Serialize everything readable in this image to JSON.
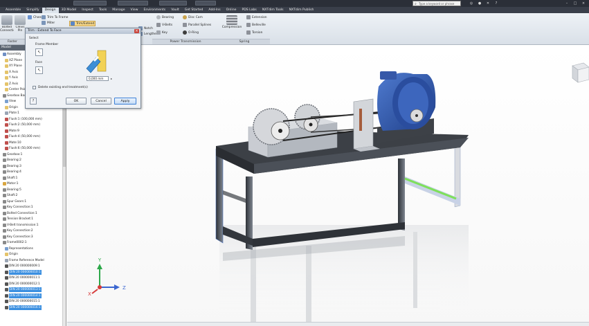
{
  "title_bar": {
    "search_placeholder": "Type a keyword or phrase"
  },
  "tabs": [
    "Assemble",
    "Simplify",
    "Design",
    "3D Model",
    "Inspect",
    "Tools",
    "Manage",
    "View",
    "Environments",
    "Vault",
    "Get Started",
    "Add-Ins",
    "Online",
    "PDS Labs",
    "NXTdim Tools",
    "NXTdim Publish"
  ],
  "active_tab": "Design",
  "ribbon": {
    "groups": [
      "Faster",
      "Power Transmission",
      "Spring"
    ],
    "left_items": [
      "Bolted Connection",
      "Clevis Pin",
      "Change",
      "Trim To Frame",
      "Miter",
      "Trim/Extend",
      "Notch",
      "Lengthen"
    ],
    "power_items": [
      "Bearing",
      "V-Belts",
      "Key",
      "Disc Cam",
      "Parallel Splines",
      "O-Ring"
    ],
    "spring_items": [
      "Compression",
      "Extension",
      "Belleville",
      "Torsion"
    ]
  },
  "dialog": {
    "title": "Trim - Extend To Face",
    "select_label": "Select",
    "frame_member_label": "Frame Member",
    "face_label": "Face",
    "offset_value": "0,000 mm",
    "delete_label": "Delete existing end treatment(s)",
    "ok": "OK",
    "cancel": "Cancel",
    "apply": "Apply"
  },
  "browser": {
    "header": "Model",
    "rows": [
      {
        "label": "Assembly",
        "indent": 1,
        "icon": "#6f8fc4",
        "sel": false
      },
      {
        "label": "XZ Plane",
        "indent": 2,
        "icon": "#e5c46a",
        "sel": false
      },
      {
        "label": "XY Plane",
        "indent": 2,
        "icon": "#e5c46a",
        "sel": false
      },
      {
        "label": "X Axis",
        "indent": 2,
        "icon": "#e5c46a",
        "sel": false
      },
      {
        "label": "Y Axis",
        "indent": 2,
        "icon": "#e5c46a",
        "sel": false
      },
      {
        "label": "Z Axis",
        "indent": 2,
        "icon": "#e5c46a",
        "sel": false
      },
      {
        "label": "Center Point",
        "indent": 2,
        "icon": "#e5c46a",
        "sel": false
      },
      {
        "label": "Gearbox Base:1",
        "indent": 1,
        "icon": "#8a8a8a",
        "sel": false
      },
      {
        "label": "View",
        "indent": 2,
        "icon": "#7aa0d0",
        "sel": false
      },
      {
        "label": "Origin",
        "indent": 2,
        "icon": "#e5c46a",
        "sel": false
      },
      {
        "label": "Plate:1",
        "indent": 2,
        "icon": "#9aa5b5",
        "sel": false
      },
      {
        "label": "Flush:1 (100,000 mm)",
        "indent": 2,
        "icon": "#c0504d",
        "sel": false
      },
      {
        "label": "Flush:2 (50,000 mm)",
        "indent": 2,
        "icon": "#c0504d",
        "sel": false
      },
      {
        "label": "Mate:9",
        "indent": 2,
        "icon": "#c0504d",
        "sel": false
      },
      {
        "label": "Flush:4 (50,000 mm)",
        "indent": 2,
        "icon": "#c0504d",
        "sel": false
      },
      {
        "label": "Mate:10",
        "indent": 2,
        "icon": "#c0504d",
        "sel": false
      },
      {
        "label": "Flush:6 (50,000 mm)",
        "indent": 2,
        "icon": "#c0504d",
        "sel": false
      },
      {
        "label": "Gearbox:1",
        "indent": 1,
        "icon": "#8a8a8a",
        "sel": false
      },
      {
        "label": "Bearing:2",
        "indent": 1,
        "icon": "#8a8a8a",
        "sel": false
      },
      {
        "label": "Bearing:3",
        "indent": 1,
        "icon": "#8a8a8a",
        "sel": false
      },
      {
        "label": "Bearing:4",
        "indent": 1,
        "icon": "#8a8a8a",
        "sel": false
      },
      {
        "label": "Shaft:1",
        "indent": 1,
        "icon": "#8a8a8a",
        "sel": false
      },
      {
        "label": "Motor:1",
        "indent": 1,
        "icon": "#d9a640",
        "sel": false
      },
      {
        "label": "Bearing:5",
        "indent": 1,
        "icon": "#8a8a8a",
        "sel": false
      },
      {
        "label": "Shaft:2",
        "indent": 1,
        "icon": "#8a8a8a",
        "sel": false
      },
      {
        "label": "Spur Gears:1",
        "indent": 1,
        "icon": "#8a8a8a",
        "sel": false
      },
      {
        "label": "Key Connection:1",
        "indent": 1,
        "icon": "#8a8a8a",
        "sel": false
      },
      {
        "label": "Bolted Connection:1",
        "indent": 1,
        "icon": "#8a8a8a",
        "sel": false
      },
      {
        "label": "Tension Bracket:1",
        "indent": 1,
        "icon": "#8a8a8a",
        "sel": false
      },
      {
        "label": "V-Belt transmission:1",
        "indent": 1,
        "icon": "#8a8a8a",
        "sel": false
      },
      {
        "label": "Key Connection:2",
        "indent": 1,
        "icon": "#8a8a8a",
        "sel": false
      },
      {
        "label": "Key Connection:3",
        "indent": 1,
        "icon": "#8a8a8a",
        "sel": false
      },
      {
        "label": "Frame0002:1",
        "indent": 1,
        "icon": "#8a8a8a",
        "sel": false
      },
      {
        "label": "Representations",
        "indent": 2,
        "icon": "#7aa0d0",
        "sel": false
      },
      {
        "label": "Origin",
        "indent": 2,
        "icon": "#e5c46a",
        "sel": false
      },
      {
        "label": "Frame Reference Model",
        "indent": 2,
        "icon": "#9aa5b5",
        "sel": false
      },
      {
        "label": "DIN 20 000000009:1",
        "indent": 2,
        "icon": "#555",
        "sel": false
      },
      {
        "label": "DIN 20 000000010:1",
        "indent": 2,
        "icon": "#555",
        "sel": true
      },
      {
        "label": "DIN 20 000000011:1",
        "indent": 2,
        "icon": "#555",
        "sel": false
      },
      {
        "label": "DIN 20 000000012:1",
        "indent": 2,
        "icon": "#555",
        "sel": false
      },
      {
        "label": "DIN 20 000000013:1",
        "indent": 2,
        "icon": "#555",
        "sel": true
      },
      {
        "label": "DIN 20 000000014:1",
        "indent": 2,
        "icon": "#555",
        "sel": true
      },
      {
        "label": "DIN 20 000000015:1",
        "indent": 2,
        "icon": "#555",
        "sel": false
      },
      {
        "label": "DIN 20 000000016:1",
        "indent": 2,
        "icon": "#555",
        "sel": true
      }
    ]
  },
  "axis_triad": {
    "x": "X",
    "y": "Y",
    "z": "Z"
  },
  "colors": {
    "motor_blue": "#2f55a8",
    "selection_green": "#7ee05a",
    "highlight_blue": "#3b8fe0",
    "table_top": "#3c4046"
  }
}
